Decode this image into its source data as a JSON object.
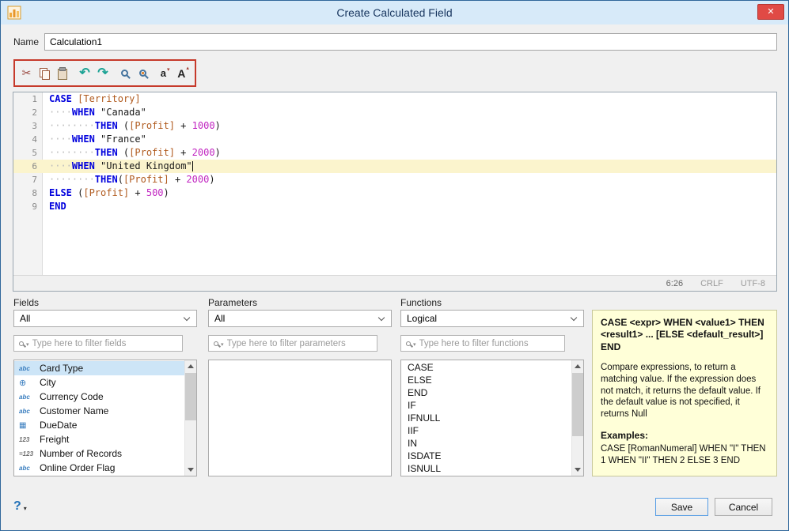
{
  "window": {
    "title": "Create Calculated Field",
    "close_glyph": "✕"
  },
  "name_row": {
    "label": "Name",
    "value": "Calculation1"
  },
  "toolbar": {
    "cut_glyph": "✂",
    "undo_glyph": "↶",
    "redo_glyph": "↷",
    "lowercase_glyph": "a",
    "uppercase_glyph": "A",
    "arrow_down": "▾",
    "arrow_up": "▴"
  },
  "editor": {
    "lines": [
      {
        "number": 1,
        "segments": [
          {
            "t": "kw",
            "v": "CASE"
          },
          {
            "t": "pl",
            "v": " "
          },
          {
            "t": "field",
            "v": "[Territory]"
          }
        ]
      },
      {
        "number": 2,
        "segments": [
          {
            "t": "ws",
            "v": "····"
          },
          {
            "t": "kw",
            "v": "WHEN"
          },
          {
            "t": "pl",
            "v": " "
          },
          {
            "t": "str",
            "v": "\"Canada\""
          }
        ]
      },
      {
        "number": 3,
        "segments": [
          {
            "t": "ws",
            "v": "········"
          },
          {
            "t": "kw",
            "v": "THEN"
          },
          {
            "t": "pl",
            "v": " ("
          },
          {
            "t": "field",
            "v": "[Profit]"
          },
          {
            "t": "pl",
            "v": " + "
          },
          {
            "t": "num",
            "v": "1000"
          },
          {
            "t": "pl",
            "v": ")"
          }
        ]
      },
      {
        "number": 4,
        "segments": [
          {
            "t": "ws",
            "v": "····"
          },
          {
            "t": "kw",
            "v": "WHEN"
          },
          {
            "t": "pl",
            "v": " "
          },
          {
            "t": "str",
            "v": "\"France\""
          }
        ]
      },
      {
        "number": 5,
        "segments": [
          {
            "t": "ws",
            "v": "········"
          },
          {
            "t": "kw",
            "v": "THEN"
          },
          {
            "t": "pl",
            "v": " ("
          },
          {
            "t": "field",
            "v": "[Profit]"
          },
          {
            "t": "pl",
            "v": " + "
          },
          {
            "t": "num",
            "v": "2000"
          },
          {
            "t": "pl",
            "v": ")"
          }
        ]
      },
      {
        "number": 6,
        "active": true,
        "caret": true,
        "segments": [
          {
            "t": "ws",
            "v": "····"
          },
          {
            "t": "kw",
            "v": "WHEN"
          },
          {
            "t": "pl",
            "v": " "
          },
          {
            "t": "str",
            "v": "\"United Kingdom\""
          }
        ]
      },
      {
        "number": 7,
        "segments": [
          {
            "t": "ws",
            "v": "········"
          },
          {
            "t": "kw",
            "v": "THEN"
          },
          {
            "t": "pl",
            "v": "("
          },
          {
            "t": "field",
            "v": "[Profit]"
          },
          {
            "t": "pl",
            "v": " + "
          },
          {
            "t": "num",
            "v": "2000"
          },
          {
            "t": "pl",
            "v": ")"
          }
        ]
      },
      {
        "number": 8,
        "segments": [
          {
            "t": "kw",
            "v": "ELSE"
          },
          {
            "t": "pl",
            "v": " ("
          },
          {
            "t": "field",
            "v": "[Profit]"
          },
          {
            "t": "pl",
            "v": " + "
          },
          {
            "t": "num",
            "v": "500"
          },
          {
            "t": "pl",
            "v": ")"
          }
        ]
      },
      {
        "number": 9,
        "segments": [
          {
            "t": "kw",
            "v": "END"
          }
        ]
      }
    ],
    "status": {
      "position": "6:26",
      "line_ending": "CRLF",
      "encoding": "UTF-8"
    }
  },
  "fields_panel": {
    "title": "Fields",
    "dropdown_value": "All",
    "filter_placeholder": "Type here to filter fields",
    "icon_glyphs": {
      "abc": "abc",
      "globe": "⊕",
      "calendar": "▦",
      "num": "123",
      "autonum": "=123"
    },
    "items": [
      {
        "icon": "abc",
        "label": "Card Type",
        "selected": true
      },
      {
        "icon": "globe",
        "label": "City"
      },
      {
        "icon": "abc",
        "label": "Currency Code"
      },
      {
        "icon": "abc",
        "label": "Customer Name"
      },
      {
        "icon": "calendar",
        "label": "DueDate"
      },
      {
        "icon": "num",
        "label": "Freight"
      },
      {
        "icon": "autonum",
        "label": "Number of Records"
      },
      {
        "icon": "abc",
        "label": "Online Order Flag"
      }
    ]
  },
  "parameters_panel": {
    "title": "Parameters",
    "dropdown_value": "All",
    "filter_placeholder": "Type here to filter parameters",
    "items": []
  },
  "functions_panel": {
    "title": "Functions",
    "dropdown_value": "Logical",
    "filter_placeholder": "Type here to filter functions",
    "items": [
      "CASE",
      "ELSE",
      "END",
      "IF",
      "IFNULL",
      "IIF",
      "IN",
      "ISDATE",
      "ISNULL"
    ]
  },
  "help_panel": {
    "signature": "CASE <expr> WHEN <value1> THEN <result1> ... [ELSE <default_result>] END",
    "description": "Compare expressions, to return a matching value. If the expression does not match, it returns the default value. If the default value is not specified, it returns Null",
    "examples_label": "Examples:",
    "example": "CASE [RomanNumeral] WHEN \"I\" THEN 1 WHEN \"II\" THEN 2 ELSE 3 END"
  },
  "footer": {
    "help_glyph": "?",
    "menu_arrow": "▾",
    "save_label": "Save",
    "cancel_label": "Cancel"
  }
}
